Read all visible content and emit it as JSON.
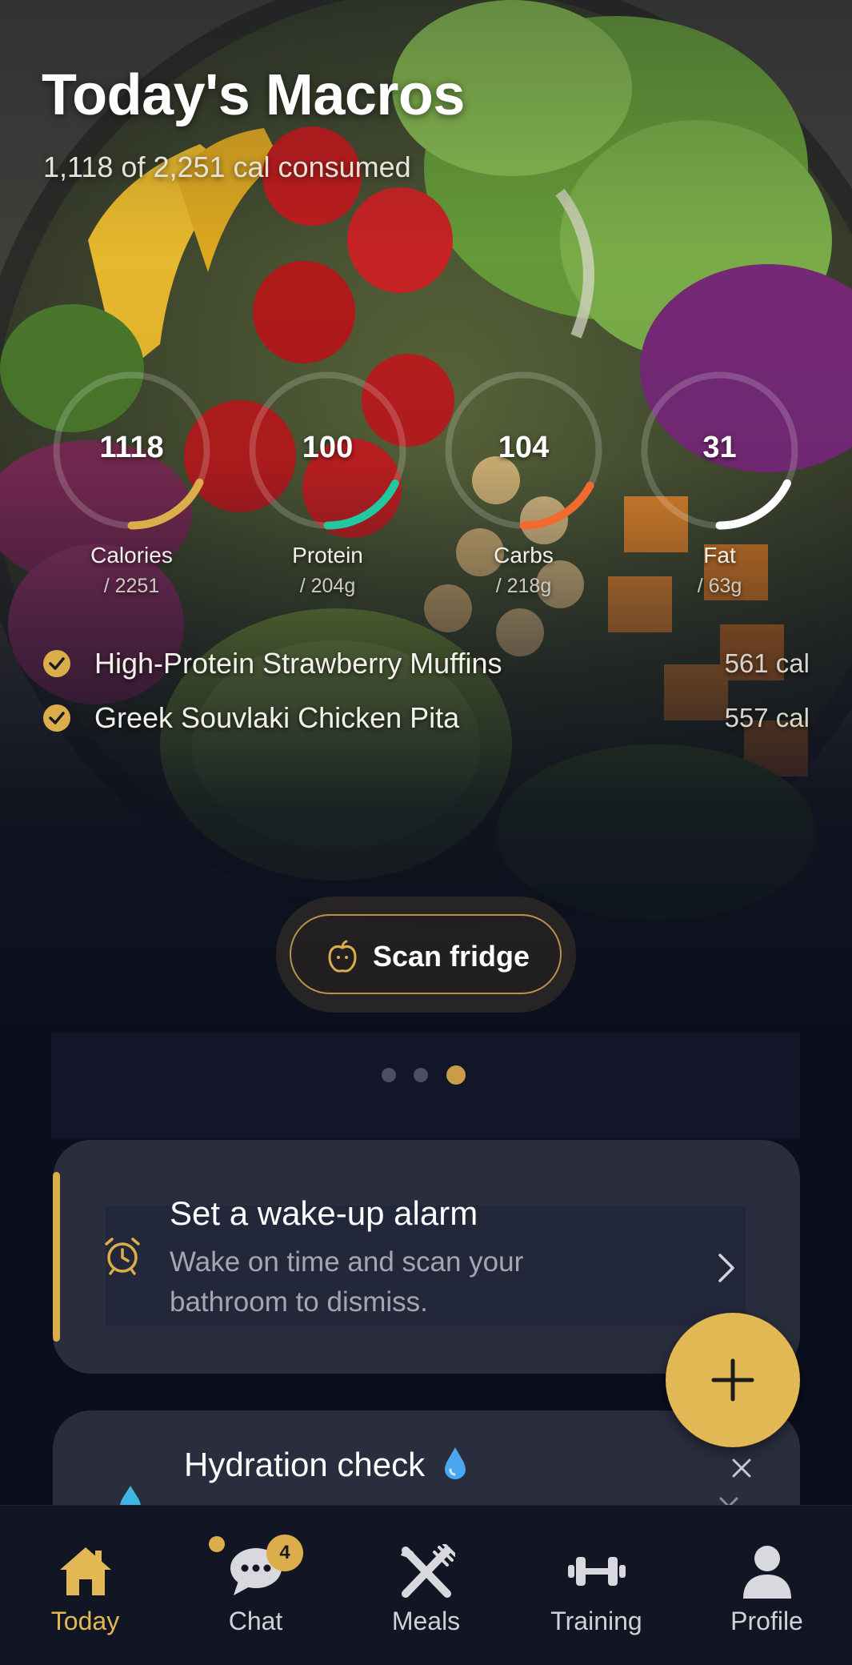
{
  "hero": {
    "title": "Today's Macros",
    "subtitle": "1,118 of 2,251 cal consumed"
  },
  "macros": [
    {
      "value": "1118",
      "label": "Calories",
      "goal": "/ 2251",
      "progress": 0.497,
      "color": "#dcae4b"
    },
    {
      "value": "100",
      "label": "Protein",
      "goal": "/ 204g",
      "progress": 0.49,
      "color": "#22c9a0"
    },
    {
      "value": "104",
      "label": "Carbs",
      "goal": "/ 218g",
      "progress": 0.477,
      "color": "#f26a2e"
    },
    {
      "value": "31",
      "label": "Fat",
      "goal": "/ 63g",
      "progress": 0.492,
      "color": "#ffffff"
    }
  ],
  "meals": [
    {
      "name": "High-Protein Strawberry Muffins",
      "cal": "561 cal"
    },
    {
      "name": "Greek Souvlaki Chicken Pita",
      "cal": "557 cal"
    }
  ],
  "scan": {
    "label": "Scan fridge",
    "icon": "apple-icon"
  },
  "carousel": {
    "active_index": 2,
    "count": 3
  },
  "alarm_card": {
    "title": "Set a wake-up alarm",
    "description": "Wake on time and scan your bathroom to dismiss.",
    "icon": "alarm-clock-icon"
  },
  "hydration_card": {
    "title": "Hydration check",
    "icon": "water-drop-icon"
  },
  "fab": {
    "icon": "plus-icon"
  },
  "nav": {
    "items": [
      {
        "label": "Today",
        "icon": "home-icon",
        "active": true
      },
      {
        "label": "Chat",
        "icon": "chat-icon",
        "badge": "4"
      },
      {
        "label": "Meals",
        "icon": "fork-knife-icon"
      },
      {
        "label": "Training",
        "icon": "dumbbell-icon"
      },
      {
        "label": "Profile",
        "icon": "person-icon"
      }
    ]
  },
  "colors": {
    "accent": "#dcae4b",
    "background": "#0b0f1d",
    "card": "#2a2d3e"
  }
}
